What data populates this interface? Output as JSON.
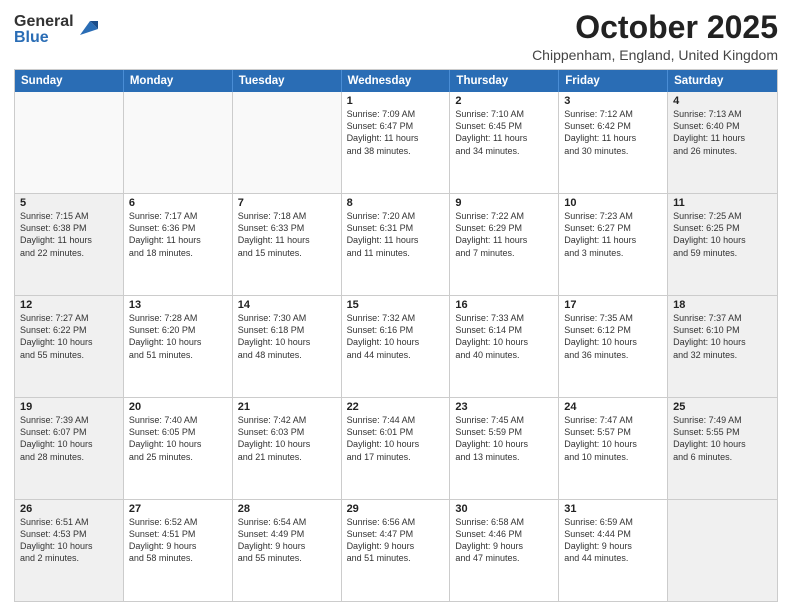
{
  "logo": {
    "general": "General",
    "blue": "Blue"
  },
  "header": {
    "title": "October 2025",
    "subtitle": "Chippenham, England, United Kingdom"
  },
  "days": [
    "Sunday",
    "Monday",
    "Tuesday",
    "Wednesday",
    "Thursday",
    "Friday",
    "Saturday"
  ],
  "weeks": [
    [
      {
        "day": "",
        "text": "",
        "empty": true
      },
      {
        "day": "",
        "text": "",
        "empty": true
      },
      {
        "day": "",
        "text": "",
        "empty": true
      },
      {
        "day": "1",
        "text": "Sunrise: 7:09 AM\nSunset: 6:47 PM\nDaylight: 11 hours\nand 38 minutes.",
        "empty": false
      },
      {
        "day": "2",
        "text": "Sunrise: 7:10 AM\nSunset: 6:45 PM\nDaylight: 11 hours\nand 34 minutes.",
        "empty": false
      },
      {
        "day": "3",
        "text": "Sunrise: 7:12 AM\nSunset: 6:42 PM\nDaylight: 11 hours\nand 30 minutes.",
        "empty": false
      },
      {
        "day": "4",
        "text": "Sunrise: 7:13 AM\nSunset: 6:40 PM\nDaylight: 11 hours\nand 26 minutes.",
        "empty": false,
        "shaded": true
      }
    ],
    [
      {
        "day": "5",
        "text": "Sunrise: 7:15 AM\nSunset: 6:38 PM\nDaylight: 11 hours\nand 22 minutes.",
        "empty": false,
        "shaded": true
      },
      {
        "day": "6",
        "text": "Sunrise: 7:17 AM\nSunset: 6:36 PM\nDaylight: 11 hours\nand 18 minutes.",
        "empty": false
      },
      {
        "day": "7",
        "text": "Sunrise: 7:18 AM\nSunset: 6:33 PM\nDaylight: 11 hours\nand 15 minutes.",
        "empty": false
      },
      {
        "day": "8",
        "text": "Sunrise: 7:20 AM\nSunset: 6:31 PM\nDaylight: 11 hours\nand 11 minutes.",
        "empty": false
      },
      {
        "day": "9",
        "text": "Sunrise: 7:22 AM\nSunset: 6:29 PM\nDaylight: 11 hours\nand 7 minutes.",
        "empty": false
      },
      {
        "day": "10",
        "text": "Sunrise: 7:23 AM\nSunset: 6:27 PM\nDaylight: 11 hours\nand 3 minutes.",
        "empty": false
      },
      {
        "day": "11",
        "text": "Sunrise: 7:25 AM\nSunset: 6:25 PM\nDaylight: 10 hours\nand 59 minutes.",
        "empty": false,
        "shaded": true
      }
    ],
    [
      {
        "day": "12",
        "text": "Sunrise: 7:27 AM\nSunset: 6:22 PM\nDaylight: 10 hours\nand 55 minutes.",
        "empty": false,
        "shaded": true
      },
      {
        "day": "13",
        "text": "Sunrise: 7:28 AM\nSunset: 6:20 PM\nDaylight: 10 hours\nand 51 minutes.",
        "empty": false
      },
      {
        "day": "14",
        "text": "Sunrise: 7:30 AM\nSunset: 6:18 PM\nDaylight: 10 hours\nand 48 minutes.",
        "empty": false
      },
      {
        "day": "15",
        "text": "Sunrise: 7:32 AM\nSunset: 6:16 PM\nDaylight: 10 hours\nand 44 minutes.",
        "empty": false
      },
      {
        "day": "16",
        "text": "Sunrise: 7:33 AM\nSunset: 6:14 PM\nDaylight: 10 hours\nand 40 minutes.",
        "empty": false
      },
      {
        "day": "17",
        "text": "Sunrise: 7:35 AM\nSunset: 6:12 PM\nDaylight: 10 hours\nand 36 minutes.",
        "empty": false
      },
      {
        "day": "18",
        "text": "Sunrise: 7:37 AM\nSunset: 6:10 PM\nDaylight: 10 hours\nand 32 minutes.",
        "empty": false,
        "shaded": true
      }
    ],
    [
      {
        "day": "19",
        "text": "Sunrise: 7:39 AM\nSunset: 6:07 PM\nDaylight: 10 hours\nand 28 minutes.",
        "empty": false,
        "shaded": true
      },
      {
        "day": "20",
        "text": "Sunrise: 7:40 AM\nSunset: 6:05 PM\nDaylight: 10 hours\nand 25 minutes.",
        "empty": false
      },
      {
        "day": "21",
        "text": "Sunrise: 7:42 AM\nSunset: 6:03 PM\nDaylight: 10 hours\nand 21 minutes.",
        "empty": false
      },
      {
        "day": "22",
        "text": "Sunrise: 7:44 AM\nSunset: 6:01 PM\nDaylight: 10 hours\nand 17 minutes.",
        "empty": false
      },
      {
        "day": "23",
        "text": "Sunrise: 7:45 AM\nSunset: 5:59 PM\nDaylight: 10 hours\nand 13 minutes.",
        "empty": false
      },
      {
        "day": "24",
        "text": "Sunrise: 7:47 AM\nSunset: 5:57 PM\nDaylight: 10 hours\nand 10 minutes.",
        "empty": false
      },
      {
        "day": "25",
        "text": "Sunrise: 7:49 AM\nSunset: 5:55 PM\nDaylight: 10 hours\nand 6 minutes.",
        "empty": false,
        "shaded": true
      }
    ],
    [
      {
        "day": "26",
        "text": "Sunrise: 6:51 AM\nSunset: 4:53 PM\nDaylight: 10 hours\nand 2 minutes.",
        "empty": false,
        "shaded": true
      },
      {
        "day": "27",
        "text": "Sunrise: 6:52 AM\nSunset: 4:51 PM\nDaylight: 9 hours\nand 58 minutes.",
        "empty": false
      },
      {
        "day": "28",
        "text": "Sunrise: 6:54 AM\nSunset: 4:49 PM\nDaylight: 9 hours\nand 55 minutes.",
        "empty": false
      },
      {
        "day": "29",
        "text": "Sunrise: 6:56 AM\nSunset: 4:47 PM\nDaylight: 9 hours\nand 51 minutes.",
        "empty": false
      },
      {
        "day": "30",
        "text": "Sunrise: 6:58 AM\nSunset: 4:46 PM\nDaylight: 9 hours\nand 47 minutes.",
        "empty": false
      },
      {
        "day": "31",
        "text": "Sunrise: 6:59 AM\nSunset: 4:44 PM\nDaylight: 9 hours\nand 44 minutes.",
        "empty": false
      },
      {
        "day": "",
        "text": "",
        "empty": true,
        "shaded": true
      }
    ]
  ]
}
